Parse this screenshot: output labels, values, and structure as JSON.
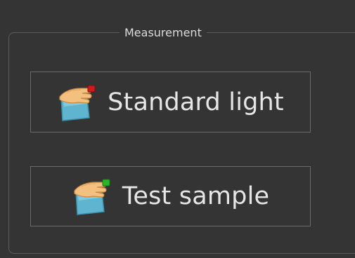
{
  "group": {
    "title": "Measurement"
  },
  "buttons": {
    "standard_light": {
      "label": "Standard light",
      "icon": "hand-on-glass-red-icon",
      "indicator_color": "#d11a1a"
    },
    "test_sample": {
      "label": "Test sample",
      "icon": "hand-on-glass-green-icon",
      "indicator_color": "#29b529"
    }
  },
  "colors": {
    "background": "#343434",
    "border": "#6a6a6a",
    "text": "#e6e6e6"
  }
}
